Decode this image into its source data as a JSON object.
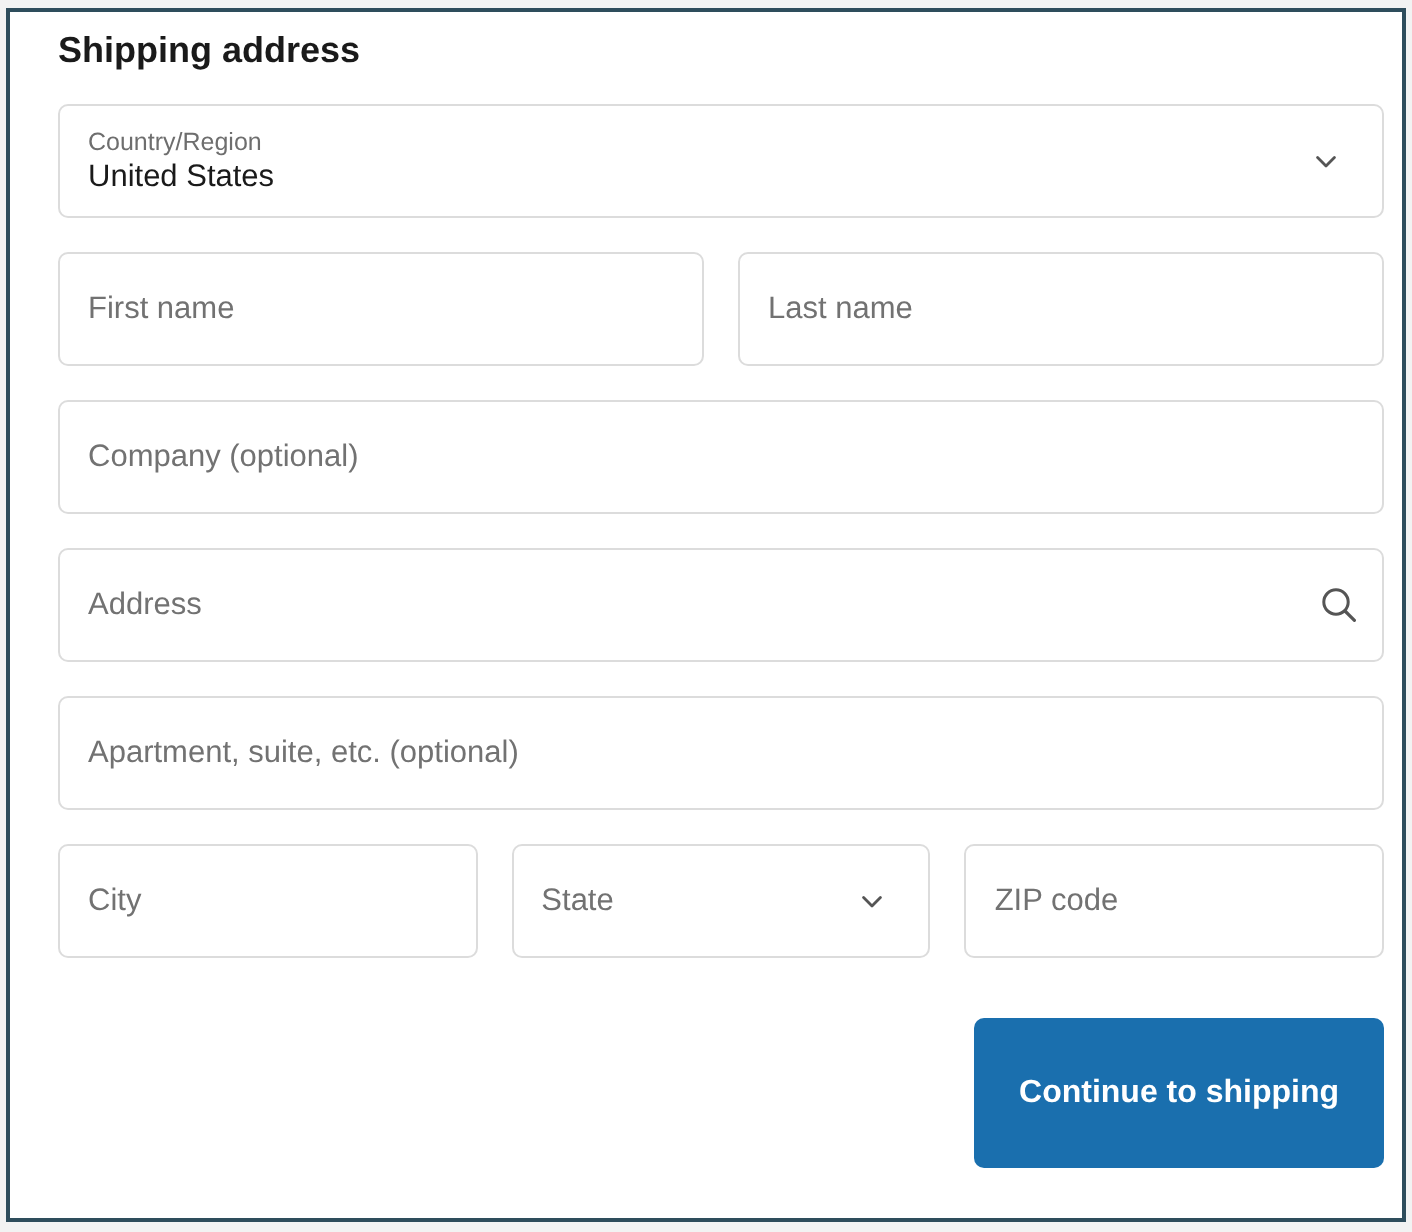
{
  "form": {
    "title": "Shipping address",
    "rows": [
      [
        {
          "kind": "select",
          "label": "Country/Region",
          "value": "United States"
        }
      ],
      [
        {
          "kind": "text",
          "placeholder": "First name"
        },
        {
          "kind": "text",
          "placeholder": "Last name"
        }
      ],
      [
        {
          "kind": "text",
          "placeholder": "Company (optional)"
        }
      ],
      [
        {
          "kind": "search",
          "placeholder": "Address"
        }
      ],
      [
        {
          "kind": "text",
          "placeholder": "Apartment, suite, etc. (optional)"
        }
      ],
      [
        {
          "kind": "text",
          "placeholder": "City"
        },
        {
          "kind": "select",
          "placeholder": "State"
        },
        {
          "kind": "text",
          "placeholder": "ZIP code"
        }
      ]
    ],
    "submit": "Continue to shipping"
  }
}
